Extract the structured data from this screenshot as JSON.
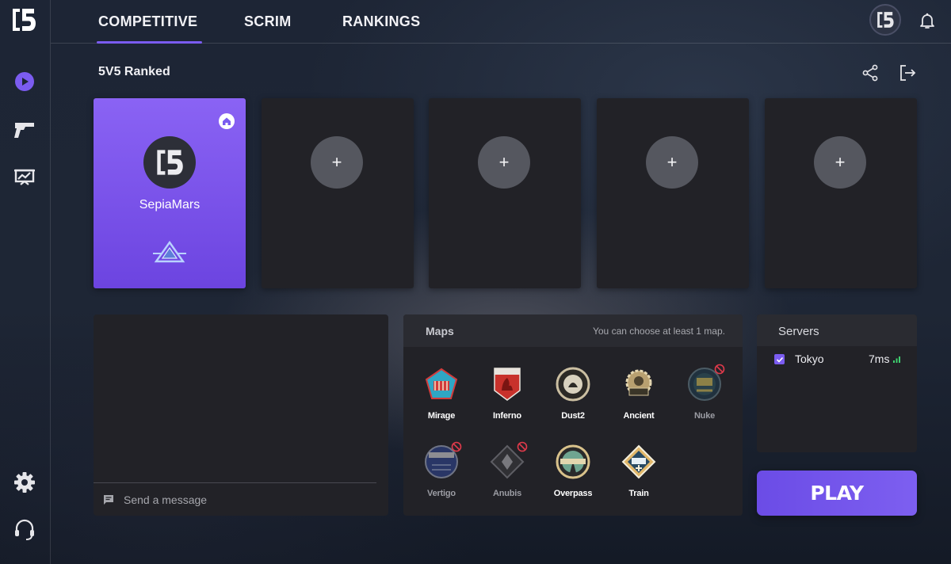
{
  "nav": {
    "tabs": [
      {
        "label": "COMPETITIVE",
        "active": true
      },
      {
        "label": "SCRIM",
        "active": false
      },
      {
        "label": "RANKINGS",
        "active": false
      }
    ]
  },
  "sidebar": {
    "items": [
      {
        "icon": "play-icon",
        "active": true
      },
      {
        "icon": "gun-icon",
        "active": false
      },
      {
        "icon": "stats-board-icon",
        "active": false
      }
    ],
    "bottom": [
      {
        "icon": "gear-icon"
      },
      {
        "icon": "headset-icon"
      }
    ]
  },
  "lobby": {
    "title": "5V5 Ranked",
    "slots": [
      {
        "type": "player",
        "name": "SepiaMars",
        "is_host": true
      },
      {
        "type": "empty",
        "label": "+"
      },
      {
        "type": "empty",
        "label": "+"
      },
      {
        "type": "empty",
        "label": "+"
      },
      {
        "type": "empty",
        "label": "+"
      }
    ]
  },
  "chat": {
    "placeholder": "Send a message"
  },
  "maps": {
    "title": "Maps",
    "hint": "You can choose at least 1 map.",
    "items": [
      {
        "name": "Mirage",
        "available": true
      },
      {
        "name": "Inferno",
        "available": true
      },
      {
        "name": "Dust2",
        "available": true
      },
      {
        "name": "Ancient",
        "available": true
      },
      {
        "name": "Nuke",
        "available": false
      },
      {
        "name": "Vertigo",
        "available": false
      },
      {
        "name": "Anubis",
        "available": false
      },
      {
        "name": "Overpass",
        "available": true
      },
      {
        "name": "Train",
        "available": true
      }
    ]
  },
  "servers": {
    "title": "Servers",
    "items": [
      {
        "name": "Tokyo",
        "ping": "7ms",
        "checked": true
      }
    ]
  },
  "play_label": "PLAY",
  "colors": {
    "accent": "#7b5cf0",
    "panel": "#222227",
    "ping_good": "#3ecf6e"
  }
}
